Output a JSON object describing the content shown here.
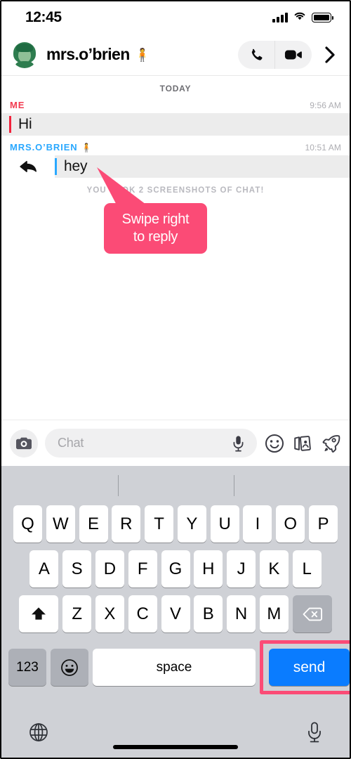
{
  "status_bar": {
    "time": "12:45",
    "signal_icon": "cellular-bars-icon",
    "wifi_icon": "wifi-icon",
    "battery_icon": "battery-full-icon"
  },
  "header": {
    "avatar_name": "bitmoji-avatar",
    "username": "mrs.o’brien",
    "username_emoji": "🧍",
    "call_button": "phone-call-icon",
    "video_button": "video-call-icon",
    "next_button": "chevron-right-icon"
  },
  "chat": {
    "day_divider": "TODAY",
    "messages": [
      {
        "sender": "ME",
        "sender_emoji": "",
        "time": "9:56 AM",
        "text": "Hi",
        "accent_color": "#f2223c",
        "is_reply": false
      },
      {
        "sender": "MRS.O’BRIEN",
        "sender_emoji": "🧍",
        "time": "10:51 AM",
        "text": "hey",
        "accent_color": "#29a8ff",
        "is_reply": true,
        "reply_icon": "reply-arrow-icon"
      }
    ],
    "screenshot_note": "YOU TOOK 2 SCREENSHOTS OF CHAT!"
  },
  "callout": {
    "line1": "Swipe right",
    "line2": "to reply",
    "color": "#fb4b76"
  },
  "input_bar": {
    "camera_icon": "camera-icon",
    "placeholder": "Chat",
    "mic_icon": "microphone-icon",
    "sticker_icon": "smiley-sticker-icon",
    "cards_icon": "cameo-cards-icon",
    "rocket_icon": "rocket-icon"
  },
  "keyboard": {
    "row1": [
      "Q",
      "W",
      "E",
      "R",
      "T",
      "Y",
      "U",
      "I",
      "O",
      "P"
    ],
    "row2": [
      "A",
      "S",
      "D",
      "F",
      "G",
      "H",
      "J",
      "K",
      "L"
    ],
    "row3": [
      "Z",
      "X",
      "C",
      "V",
      "B",
      "N",
      "M"
    ],
    "shift_icon": "shift-up-arrow-icon",
    "backspace_icon": "backspace-delete-icon",
    "numeric_label": "123",
    "emoji_icon": "emoji-smiley-icon",
    "space_label": "space",
    "send_label": "send",
    "send_color": "#0a7cff",
    "highlight_color": "#fb4b76",
    "globe_icon": "globe-language-icon",
    "dictation_icon": "dictation-microphone-icon"
  }
}
